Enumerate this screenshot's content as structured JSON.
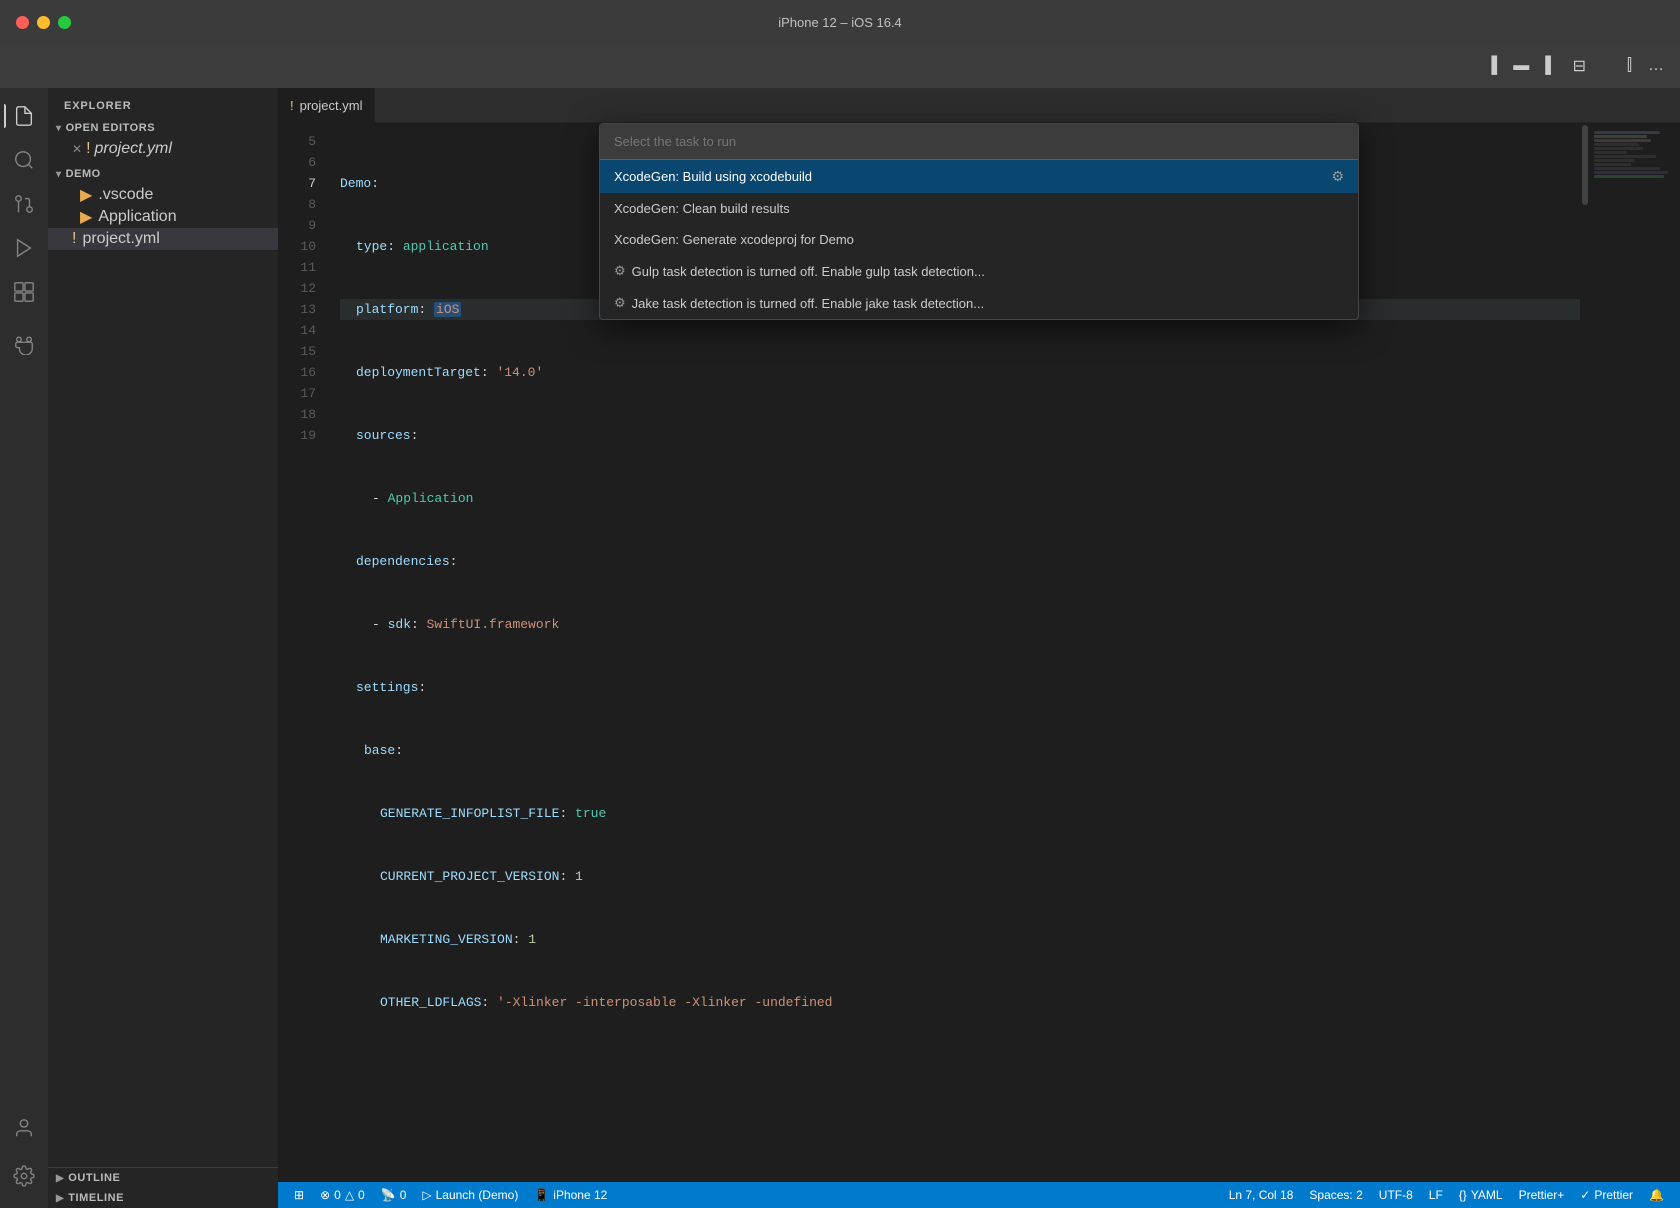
{
  "window": {
    "title": "iPhone 12 – iOS 16.4",
    "traffic_lights": [
      "close",
      "minimize",
      "maximize"
    ]
  },
  "vscode": {
    "title_bar": {
      "icons": [
        "split-editor",
        "toggle-panel",
        "toggle-sidebar",
        "layout"
      ]
    },
    "activity_bar": {
      "items": [
        {
          "name": "explorer",
          "icon": "📄",
          "active": true
        },
        {
          "name": "search",
          "icon": "🔍",
          "active": false
        },
        {
          "name": "source-control",
          "icon": "⑂",
          "active": false
        },
        {
          "name": "run-debug",
          "icon": "▷",
          "active": false
        },
        {
          "name": "extensions",
          "icon": "⊞",
          "active": false
        },
        {
          "name": "android",
          "icon": "🤖",
          "active": false
        }
      ],
      "bottom": [
        {
          "name": "account",
          "icon": "👤"
        },
        {
          "name": "settings",
          "icon": "⚙"
        }
      ]
    },
    "sidebar": {
      "title": "EXPLORER",
      "sections": [
        {
          "name": "open-editors",
          "label": "OPEN EDITORS",
          "expanded": true,
          "items": [
            {
              "name": "project.yml",
              "modified": true,
              "close": true,
              "italic": true
            }
          ]
        },
        {
          "name": "demo",
          "label": "DEMO",
          "expanded": true,
          "items": [
            {
              "name": ".vscode",
              "type": "folder",
              "indent": 1
            },
            {
              "name": "Application",
              "type": "folder",
              "indent": 1
            },
            {
              "name": "project.yml",
              "type": "file-modified",
              "indent": 1,
              "selected": true
            }
          ]
        }
      ],
      "bottom": [
        {
          "label": "OUTLINE"
        },
        {
          "label": "TIMELINE"
        }
      ]
    },
    "editor": {
      "tabs": [
        {
          "label": "project.yml",
          "active": true,
          "modified": true
        }
      ],
      "file": "project.yml",
      "code_lines": [
        {
          "num": 5,
          "content": "Demo:"
        },
        {
          "num": 6,
          "content": "  type: application"
        },
        {
          "num": 7,
          "content": "  platform: iOS",
          "highlight": "iOS"
        },
        {
          "num": 8,
          "content": "  deploymentTarget: '14.0'"
        },
        {
          "num": 9,
          "content": "  sources:"
        },
        {
          "num": 10,
          "content": "    - Application"
        },
        {
          "num": 11,
          "content": "  dependencies:"
        },
        {
          "num": 12,
          "content": "    - sdk: SwiftUI.framework"
        },
        {
          "num": 13,
          "content": "  settings:"
        },
        {
          "num": 14,
          "content": "    base:"
        },
        {
          "num": 15,
          "content": "      GENERATE_INFOPLIST_FILE: true"
        },
        {
          "num": 16,
          "content": "      CURRENT_PROJECT_VERSION: 1"
        },
        {
          "num": 17,
          "content": "      MARKETING_VERSION: 1"
        },
        {
          "num": 18,
          "content": "      OTHER_LDFLAGS: '-Xlinker -interposable -Xlinker -undefined"
        },
        {
          "num": 19,
          "content": ""
        }
      ]
    },
    "status_bar": {
      "left": [
        {
          "icon": "⊞",
          "text": ""
        },
        {
          "icon": "⚠",
          "text": "0"
        },
        {
          "icon": "△",
          "text": "0"
        },
        {
          "icon": "📡",
          "text": "0"
        },
        {
          "icon": "▷",
          "text": "Launch (Demo)"
        },
        {
          "icon": "📱",
          "text": "iPhone 12"
        }
      ],
      "right": [
        {
          "text": "Ln 7, Col 18"
        },
        {
          "text": "Spaces: 2"
        },
        {
          "text": "UTF-8"
        },
        {
          "text": "LF"
        },
        {
          "icon": "{}",
          "text": "YAML"
        },
        {
          "text": "Prettier+"
        },
        {
          "icon": "✓",
          "text": "Prettier"
        },
        {
          "icon": "🔔",
          "text": ""
        }
      ]
    }
  },
  "task_picker": {
    "placeholder": "Select the task to run",
    "items": [
      {
        "label": "XcodeGen: Build using xcodebuild",
        "selected": true,
        "has_gear": true
      },
      {
        "label": "XcodeGen: Clean build results",
        "selected": false,
        "has_gear": false
      },
      {
        "label": "XcodeGen: Generate xcodeproj for Demo",
        "selected": false,
        "has_gear": false
      },
      {
        "label": "Gulp task detection is turned off. Enable gulp task detection...",
        "selected": false,
        "has_gear": true
      },
      {
        "label": "Jake task detection is turned off. Enable jake task detection...",
        "selected": false,
        "has_gear": true
      }
    ]
  }
}
